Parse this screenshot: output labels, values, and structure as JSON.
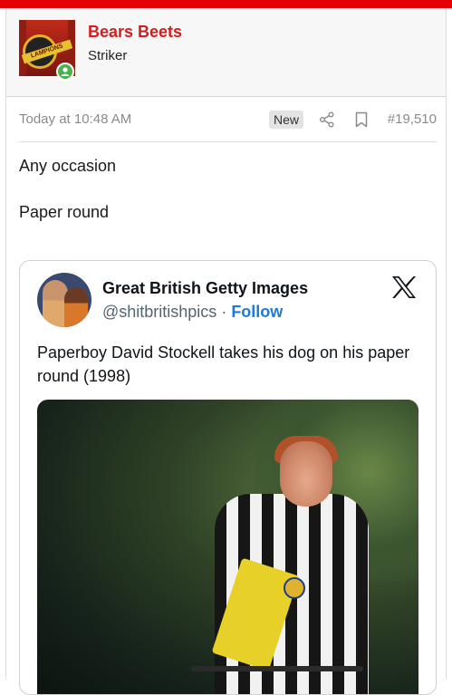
{
  "colors": {
    "accent_red": "#e60000",
    "username_red": "#d61d1d",
    "online_green": "#4caf50",
    "follow_blue": "#1d7bd8"
  },
  "user": {
    "name": "Bears Beets",
    "title": "Striker",
    "avatar_text": "LAMPIONS",
    "online": true
  },
  "post": {
    "timestamp": "Today at 10:48 AM",
    "badge": "New",
    "number": "#19,510",
    "lines": [
      "Any occasion",
      "Paper round"
    ]
  },
  "tweet": {
    "author": "Great British Getty Images",
    "handle": "@shitbritishpics",
    "separator": " · ",
    "follow_label": "Follow",
    "text": "Paperboy David Stockell takes his dog on his paper round (1998)",
    "platform_icon": "x-logo-icon",
    "photo_subject": "paperboy"
  },
  "icons": {
    "share": "share-icon",
    "bookmark": "bookmark-icon",
    "online": "user-online-icon"
  }
}
